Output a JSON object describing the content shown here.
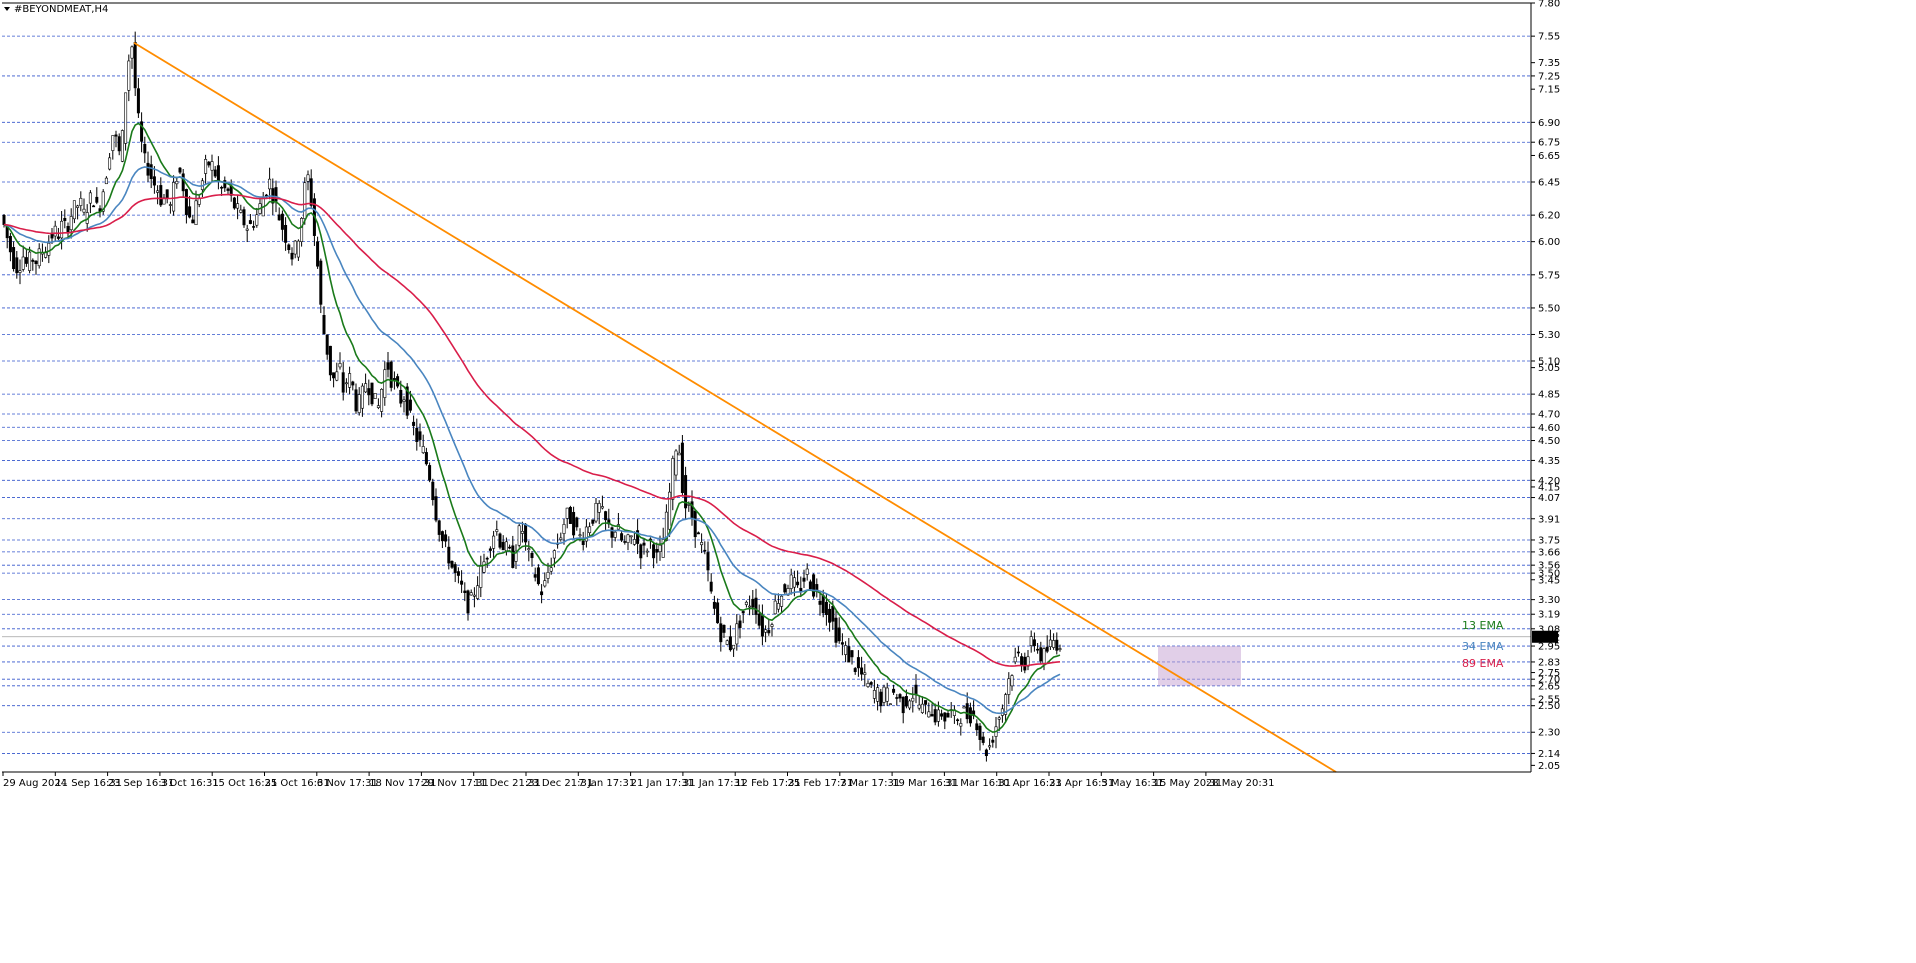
{
  "window": {
    "title": "#BEYONDMEAT,H4"
  },
  "chart_data": {
    "type": "candlestick",
    "instrument": "#BEYONDMEAT",
    "timeframe": "H4",
    "ylim": [
      2.0,
      7.8
    ],
    "y_ticks": [
      7.8,
      7.55,
      7.35,
      7.25,
      7.15,
      6.9,
      6.75,
      6.65,
      6.45,
      6.2,
      6.0,
      5.75,
      5.5,
      5.3,
      5.1,
      5.05,
      4.85,
      4.7,
      4.6,
      4.5,
      4.35,
      4.2,
      4.15,
      4.07,
      3.91,
      3.75,
      3.66,
      3.56,
      3.5,
      3.45,
      3.3,
      3.19,
      3.08,
      2.95,
      2.83,
      2.75,
      2.7,
      2.65,
      2.55,
      2.5,
      2.3,
      2.14,
      2.05
    ],
    "y_tick_labels": [
      "7.80",
      "7.55",
      "7.35",
      "7.25",
      "7.15",
      "6.90",
      "6.75",
      "6.65",
      "6.45",
      "6.20",
      "6.00",
      "5.75",
      "5.50",
      "5.30",
      "5.10",
      "5.05",
      "4.85",
      "4.70",
      "4.60",
      "4.50",
      "4.35",
      "4.20",
      "4.15",
      "4.07",
      "3.91",
      "3.75",
      "3.66",
      "3.56",
      "3.50",
      "3.45",
      "3.30",
      "3.19",
      "3.08",
      "2.95",
      "2.83",
      "2.75",
      "2.70",
      "2.65",
      "2.55",
      "2.50",
      "2.30",
      "2.14",
      "2.05"
    ],
    "level_lines": [
      7.8,
      7.55,
      7.25,
      6.9,
      6.75,
      6.45,
      6.2,
      6.0,
      5.75,
      5.5,
      5.3,
      5.1,
      4.85,
      4.7,
      4.6,
      4.5,
      4.35,
      4.2,
      4.07,
      3.91,
      3.75,
      3.66,
      3.56,
      3.5,
      3.3,
      3.19,
      3.08,
      2.95,
      2.83,
      2.7,
      2.65,
      2.5,
      2.3,
      2.14
    ],
    "current_price": 3.02,
    "current_price_label": "3.02",
    "x_labels": [
      "29 Aug 2024",
      "11 Sep 16:31",
      "23 Sep 16:31",
      "3 Oct 16:31",
      "15 Oct 16:31",
      "25 Oct 16:31",
      "6 Nov 17:31",
      "18 Nov 17:31",
      "29 Nov 17:31",
      "11 Dec 21:31",
      "23 Dec 21:31",
      "7 Jan 17:31",
      "21 Jan 17:31",
      "31 Jan 17:31",
      "12 Feb 17:31",
      "25 Feb 17:31",
      "7 Mar 17:31",
      "19 Mar 16:31",
      "31 Mar 16:31",
      "10 Apr 16:31",
      "23 Apr 16:31",
      "5 May 16:31",
      "15 May 20:31",
      "28 May 20:31"
    ],
    "price_path_x": [
      0,
      4,
      8,
      13,
      17,
      21,
      26,
      30,
      35,
      40,
      44,
      48,
      52,
      57,
      61,
      65,
      70,
      74,
      78,
      83,
      87,
      91,
      96,
      100,
      104,
      109,
      113,
      117,
      122,
      126,
      130,
      135,
      139,
      143,
      148,
      152,
      156,
      161,
      165,
      169,
      174,
      178,
      182,
      187,
      191,
      195,
      200,
      204,
      208,
      213,
      217,
      221,
      226,
      230,
      234,
      239,
      243,
      247,
      252,
      256,
      260,
      265,
      269,
      273,
      278,
      282,
      286,
      291,
      295,
      299,
      304,
      308,
      312,
      317,
      321,
      325,
      330,
      334,
      338,
      343,
      347,
      351,
      356,
      360,
      364,
      369,
      373,
      377,
      382,
      386,
      390,
      395,
      399,
      403,
      408,
      412,
      416,
      421,
      425,
      429,
      434,
      438,
      442,
      447,
      451,
      455,
      460,
      464,
      468,
      473,
      477,
      481,
      486,
      490,
      494,
      499,
      503,
      507,
      512,
      516,
      520,
      525,
      529,
      533,
      538,
      542,
      546,
      551,
      555,
      559,
      564,
      568,
      572,
      577,
      581,
      585,
      590,
      594,
      598,
      603,
      607,
      611,
      616,
      620,
      624,
      629,
      633,
      637,
      642,
      646,
      650,
      655,
      659,
      663,
      668,
      672,
      676,
      681,
      685,
      689,
      694,
      698,
      702,
      707,
      711,
      715,
      720,
      724,
      728,
      733,
      737,
      741,
      746,
      750,
      754,
      759,
      763,
      767,
      772,
      776,
      780,
      785,
      789,
      793,
      798,
      802,
      806,
      811,
      815,
      819,
      824,
      828,
      832,
      837,
      841,
      845,
      850,
      854,
      858,
      863,
      867,
      871,
      876,
      880,
      884,
      889,
      893,
      897,
      902,
      906,
      910,
      915,
      919,
      923,
      928,
      932,
      936,
      941,
      945,
      949,
      954,
      958,
      962,
      967,
      971,
      975,
      980,
      984,
      988,
      993,
      997,
      1001,
      1006,
      1010,
      1014,
      1019,
      1023,
      1027,
      1032,
      1036,
      1040,
      1045,
      1049,
      1053,
      1058,
      1062,
      1066,
      1071,
      1075,
      1079,
      1084,
      1088,
      1092,
      1097,
      1101,
      1105,
      1110,
      1114,
      1118,
      1123,
      1127,
      1131,
      1136,
      1140,
      1144,
      1149,
      1153,
      1157,
      1162,
      1166,
      1170,
      1175,
      1179,
      1183,
      1188,
      1192,
      1196,
      1201,
      1205,
      1209,
      1214,
      1218,
      1222,
      1227
    ],
    "price_path": [
      6.35,
      6.2,
      6.1,
      5.95,
      5.85,
      5.8,
      5.9,
      5.82,
      5.88,
      5.85,
      5.92,
      5.95,
      6.0,
      6.08,
      6.05,
      6.12,
      6.1,
      6.2,
      6.25,
      6.3,
      6.2,
      6.28,
      6.35,
      6.25,
      6.3,
      6.5,
      6.7,
      6.85,
      6.65,
      6.8,
      7.3,
      7.5,
      7.1,
      6.8,
      6.6,
      6.55,
      6.45,
      6.4,
      6.3,
      6.35,
      6.25,
      6.45,
      6.55,
      6.4,
      6.2,
      6.15,
      6.3,
      6.4,
      6.55,
      6.6,
      6.55,
      6.45,
      6.38,
      6.4,
      6.32,
      6.25,
      6.2,
      6.15,
      6.1,
      6.15,
      6.2,
      6.3,
      6.4,
      6.45,
      6.3,
      6.2,
      6.1,
      6.0,
      5.9,
      5.95,
      6.15,
      6.4,
      6.5,
      6.1,
      5.8,
      5.4,
      5.2,
      5.0,
      4.95,
      5.05,
      4.85,
      5.0,
      4.9,
      4.75,
      4.8,
      4.95,
      4.9,
      4.8,
      4.75,
      4.95,
      5.1,
      4.95,
      4.9,
      4.8,
      4.85,
      4.7,
      4.6,
      4.5,
      4.45,
      4.35,
      4.2,
      4.0,
      3.85,
      3.7,
      3.65,
      3.55,
      3.45,
      3.4,
      3.3,
      3.25,
      3.35,
      3.45,
      3.55,
      3.65,
      3.75,
      3.85,
      3.75,
      3.7,
      3.65,
      3.6,
      3.75,
      3.85,
      3.7,
      3.6,
      3.5,
      3.4,
      3.35,
      3.5,
      3.6,
      3.7,
      3.8,
      3.9,
      3.95,
      3.85,
      3.8,
      3.75,
      3.85,
      3.9,
      3.95,
      4.0,
      3.9,
      3.85,
      3.8,
      3.85,
      3.75,
      3.7,
      3.75,
      3.8,
      3.7,
      3.65,
      3.7,
      3.75,
      3.6,
      3.65,
      3.8,
      4.05,
      4.3,
      4.55,
      4.2,
      4.0,
      3.95,
      3.85,
      3.75,
      3.65,
      3.5,
      3.3,
      3.15,
      3.05,
      3.0,
      2.95,
      3.0,
      3.1,
      3.2,
      3.25,
      3.3,
      3.25,
      3.1,
      3.05,
      3.1,
      3.2,
      3.3,
      3.35,
      3.4,
      3.45,
      3.4,
      3.35,
      3.45,
      3.5,
      3.4,
      3.35,
      3.3,
      3.25,
      3.2,
      3.1,
      3.0,
      2.95,
      2.9,
      2.85,
      2.8,
      2.75,
      2.7,
      2.65,
      2.6,
      2.6,
      2.55,
      2.6,
      2.55,
      2.6,
      2.55,
      2.5,
      2.55,
      2.6,
      2.55,
      2.5,
      2.45,
      2.5,
      2.45,
      2.4,
      2.45,
      2.4,
      2.45,
      2.4,
      2.42,
      2.45,
      2.42,
      2.45,
      2.38,
      2.25,
      2.15,
      2.2,
      2.3,
      2.4,
      2.5,
      2.65,
      2.75,
      2.85,
      2.9,
      2.8,
      2.9,
      3.0,
      2.95,
      2.85,
      2.9,
      2.95,
      3.0,
      2.95,
      3.05
    ],
    "trendline": {
      "start_x": 134,
      "start_price": 7.5,
      "end_x": 1336,
      "end_price": 2.0,
      "color": "#ff8c00"
    },
    "highlight_box": {
      "x1": 1158,
      "x2": 1241,
      "price_top": 2.95,
      "price_bottom": 2.65,
      "color": "#c8a8d6"
    },
    "series": [
      {
        "name": "13 EMA",
        "color": "#1a7a1a",
        "period": 13
      },
      {
        "name": "34 EMA",
        "color": "#4a86c0",
        "period": 34
      },
      {
        "name": "89 EMA",
        "color": "#d91e4a",
        "period": 89
      }
    ],
    "grid": true,
    "colors": {
      "background": "#ffffff",
      "level_line": "#3355cc",
      "candle": "#000000",
      "axis": "#000000",
      "price_tag_bg": "#000000",
      "price_tag_fg": "#ffffff"
    }
  }
}
